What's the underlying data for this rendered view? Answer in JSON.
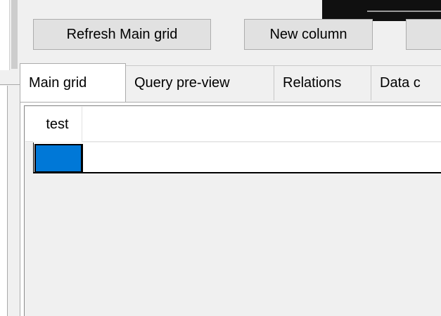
{
  "toolbar": {
    "refresh_label": "Refresh Main grid",
    "new_column_label": "New column",
    "partial_button_label": ""
  },
  "tabs": [
    {
      "label": "Main grid",
      "active": true
    },
    {
      "label": "Query pre-view",
      "active": false
    },
    {
      "label": "Relations",
      "active": false
    },
    {
      "label": "Data c",
      "active": false
    }
  ],
  "grid": {
    "columns": [
      "test"
    ],
    "rows": [
      [
        ""
      ]
    ]
  },
  "colors": {
    "window_background": "#f0f0f0",
    "selected_cell": "#0078d7",
    "button_background": "#e1e1e1"
  }
}
